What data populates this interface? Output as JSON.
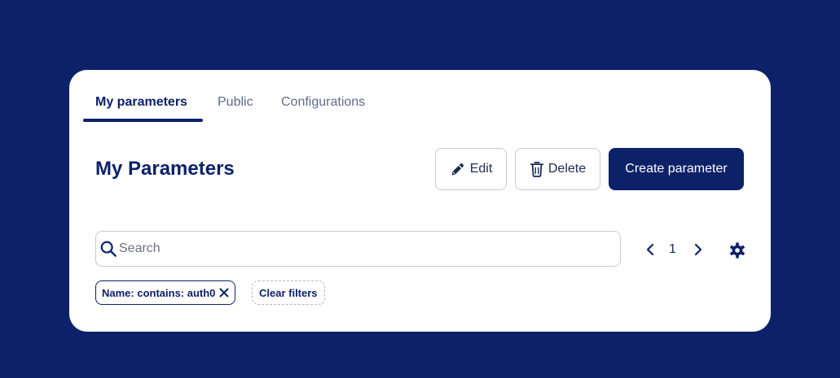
{
  "tabs": [
    {
      "label": "My parameters",
      "active": true
    },
    {
      "label": "Public",
      "active": false
    },
    {
      "label": "Configurations",
      "active": false
    }
  ],
  "page_title": "My Parameters",
  "actions": {
    "edit_label": "Edit",
    "delete_label": "Delete",
    "create_label": "Create parameter"
  },
  "search": {
    "placeholder": "Search",
    "value": ""
  },
  "pagination": {
    "current_page": "1"
  },
  "filters": {
    "chips": [
      {
        "label": "Name: contains: auth0"
      }
    ],
    "clear_label": "Clear filters"
  },
  "icons": {
    "search": "search-icon",
    "edit": "pencil-icon",
    "delete": "trash-icon",
    "prev": "chevron-left-icon",
    "next": "chevron-right-icon",
    "settings": "gear-icon",
    "remove": "close-icon"
  },
  "colors": {
    "background": "#0d2169",
    "primary": "#0d2169",
    "card": "#ffffff",
    "muted_text": "#5f6b87"
  }
}
